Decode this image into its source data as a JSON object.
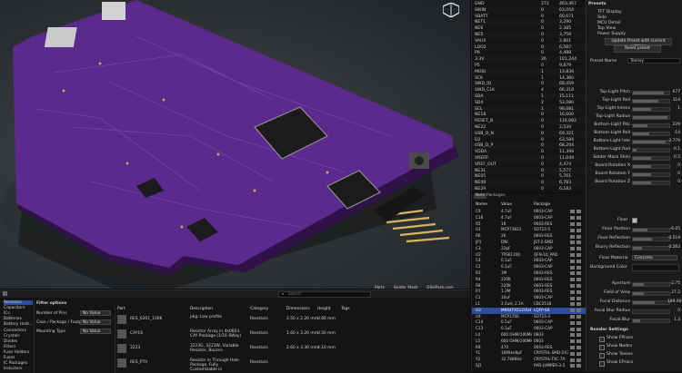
{
  "viewport": {
    "accent_board": "#5b2a8c"
  },
  "nets": [
    [
      "GND",
      "272",
      "463,467"
    ],
    [
      "SWIN",
      "0",
      "63,054"
    ],
    [
      "VBATT",
      "0",
      "60,671"
    ],
    [
      "NET1",
      "0",
      "3,290"
    ],
    [
      "NE6",
      "0",
      "2,385"
    ],
    [
      "NE5",
      "0",
      "3,759"
    ],
    [
      "VAUX",
      "0",
      "2,801"
    ],
    [
      "LDO2",
      "0",
      "6,587"
    ],
    [
      "P9",
      "0",
      "4,488"
    ],
    [
      "3.3V",
      "26",
      "101,244"
    ],
    [
      "P5",
      "0",
      "9,879"
    ],
    [
      "MOSI",
      "1",
      "13,836"
    ],
    [
      "SCK",
      "1",
      "14,360"
    ],
    [
      "SWD_IO",
      "0",
      "68,459"
    ],
    [
      "SWD_CLK",
      "4",
      "66,318"
    ],
    [
      "SDA",
      "1",
      "15,111"
    ],
    [
      "SD4",
      "2",
      "53,080"
    ],
    [
      "SCL",
      "1",
      "98,081"
    ],
    [
      "NE18",
      "0",
      "16,600"
    ],
    [
      "RESET_B",
      "0",
      "116,082"
    ],
    [
      "NE22",
      "0",
      "2,534"
    ],
    [
      "USB_D_N",
      "0",
      "69,321"
    ],
    [
      "D2",
      "0",
      "63,584"
    ],
    [
      "USB_D_P",
      "0",
      "68,204"
    ],
    [
      "VDDA",
      "0",
      "11,398"
    ],
    [
      "VREFP",
      "0",
      "11,049"
    ],
    [
      "VREF_OUT",
      "0",
      "4,474"
    ],
    [
      "NE31",
      "0",
      "5,577"
    ],
    [
      "NE05",
      "0",
      "5,761"
    ],
    [
      "NE08",
      "0",
      "6,783"
    ],
    [
      "NE29",
      "0",
      "6,183"
    ]
  ],
  "parts_tabs": [
    "Nets",
    "Packages"
  ],
  "parts_headers": [
    "Name",
    "Value",
    "Package"
  ],
  "parts": [
    [
      "C9",
      "4.7uF",
      "0603-CAP"
    ],
    [
      "C16",
      "4.7uF",
      "0603-CAP"
    ],
    [
      "R5",
      "1K",
      "0603-RES"
    ],
    [
      "U1",
      "MCP73831",
      "SOT23-5"
    ],
    [
      "R6",
      "2K",
      "0603-RES"
    ],
    [
      "JP1",
      "DNI",
      "JST-2-SMD"
    ],
    [
      "C3",
      "22pF",
      "0603-CAP"
    ],
    [
      "U2",
      "TPS61200",
      "QFN-10_PAD"
    ],
    [
      "C4",
      "0.1uF",
      "0603-CAP"
    ],
    [
      "C2",
      "0.1uF",
      "0603-CAP"
    ],
    [
      "R3",
      "3M",
      "0603-RES"
    ],
    [
      "R4",
      "220K",
      "0603-RES"
    ],
    [
      "R8",
      "220K",
      "0603-RES"
    ],
    [
      "R7",
      "1.2M",
      "0603-RES"
    ],
    [
      "C1",
      "10uF",
      "0603-CAP"
    ],
    [
      "L1",
      "2.2uH, 2.1A",
      "CBC2518"
    ],
    [
      "U3",
      "MK64FX512VLH",
      "LQFP-64"
    ],
    [
      "U4",
      "MCP1700",
      "SOT23-3"
    ],
    [
      "C14",
      "0.1uF",
      "0603-CAP"
    ],
    [
      "C13",
      "0.1uF",
      "0603-CAP"
    ],
    [
      "L4",
      "600 OHM/100MHz",
      "0603"
    ],
    [
      "L5",
      "600 OHM/100MHz",
      "0603"
    ],
    [
      "R9",
      "470",
      "0603-RES"
    ],
    [
      "Y1",
      "16MHz/8pF",
      "CRYSTAL-SMD-5X3"
    ],
    [
      "Y2",
      "32.768KHz",
      "CRYSTAL-TXC-7A"
    ],
    [
      "SJ1",
      "",
      "PAD-JUMPER-3-2"
    ]
  ],
  "parts_selected": 16,
  "settings": {
    "presets_title": "Presets",
    "presets": [
      "TFT Display",
      "Side",
      "MCU Detail",
      "Top View",
      "Power Supply"
    ],
    "update_btn": "Update Preset with current settings",
    "reset_btn": "Reset preset",
    "preset_name_label": "Preset Name",
    "preset_name_value": "Teensy",
    "sliders": [
      {
        "label": "Top-Light Pitch",
        "value": "677",
        "frac": 0.85
      },
      {
        "label": "Top-Light Roll",
        "value": "314",
        "frac": 0.7
      },
      {
        "label": "Top-Light Intens",
        "value": "1",
        "frac": 0.5
      },
      {
        "label": "Top-Light Radius",
        "value": "",
        "frac": 0.95
      },
      {
        "label": "Bottom-Light Pitc",
        "value": "229",
        "frac": 0.4
      },
      {
        "label": "Bottom-Light Roll",
        "value": "-14",
        "frac": 0.45
      },
      {
        "label": "Bottom-Light Inte",
        "value": "3.776",
        "frac": 0.9
      },
      {
        "label": "Bottom-Light Rad",
        "value": "0.1",
        "frac": 0.1
      },
      {
        "label": "Solder Mask Shini",
        "value": "0.5",
        "frac": 0.5
      },
      {
        "label": "Board Rotation X",
        "value": "0",
        "frac": 0.5
      },
      {
        "label": "Board Rotation Y",
        "value": "0",
        "frac": 0.5
      },
      {
        "label": "Board Rotation Z",
        "value": "0",
        "frac": 0.5
      }
    ],
    "floor_label": "Floor",
    "floor_sliders": [
      {
        "label": "Floor Position",
        "value": "-6.05",
        "frac": 0.4
      },
      {
        "label": "Floor Reflection",
        "value": "0.519",
        "frac": 0.52
      },
      {
        "label": "Blurry Reflection",
        "value": "0.262",
        "frac": 0.26
      }
    ],
    "floor_material_label": "Floor Material",
    "floor_material_value": "Concrete",
    "background_color_label": "Background Color",
    "camera_sliders": [
      {
        "label": "Aperture",
        "value": "-2.75",
        "frac": 0.3
      },
      {
        "label": "Field of View",
        "value": "27.2",
        "frac": 0.3
      },
      {
        "label": "Focal Distance",
        "value": "189.909",
        "frac": 0.6
      },
      {
        "label": "Focal Blur Radius",
        "value": "0",
        "frac": 0.0
      },
      {
        "label": "Focal Blur",
        "value": "1.3",
        "frac": 0.2
      }
    ],
    "render_title": "Render Settings",
    "render_checks": [
      "Show FPrace",
      "Show Nodes",
      "Show Tesses",
      "Show EPrace"
    ]
  },
  "library": {
    "categories": [
      "Resistors",
      "Capacitors",
      "ICs",
      "Batteries",
      "Battery Hold...",
      "Connectors",
      "Crystals",
      "Diodes",
      "Filters",
      "Fuse Holders",
      "Fuses",
      "IC Packages",
      "Inductors"
    ],
    "selected_category": 0,
    "filter_title": "Filter options",
    "filters": [
      {
        "label": "Number of Pins",
        "value": "No Value"
      },
      {
        "label": "Case / Package / Footprint",
        "value": "No Value"
      },
      {
        "label": "Mounting Type",
        "value": "No Value"
      }
    ],
    "search_placeholder": "Search",
    "top_tabs": [
      "Parts",
      "Solder Mask",
      "OSHPark.com"
    ],
    "headers": [
      "Part",
      "Description",
      "Category",
      "Dimensions",
      "Height",
      "Tags"
    ],
    "rows": [
      {
        "part": "RES_0201_100K",
        "desc": "pkg: Low profile",
        "cat": "Resistors",
        "dim": "2.50 x 2.20 mm",
        "h": "0.66 mm"
      },
      {
        "part": "CAY16",
        "desc": "Resistor Array in 4x0603 CAY Package (1/16 6Way)",
        "cat": "Resistors",
        "dim": "1.60 x 3.20 mm",
        "h": "0.50 mm"
      },
      {
        "part": "3223",
        "desc": "3223G, 3223W, Variable Resistor, Bourns",
        "cat": "Resistors",
        "dim": "2.60 x 3.30 mm",
        "h": "4.10 mm"
      },
      {
        "part": "RES_PTH",
        "desc": "Resistor in Through Hole Package, Fully Customizable in",
        "cat": "Resistors",
        "dim": "",
        "h": ""
      }
    ]
  }
}
